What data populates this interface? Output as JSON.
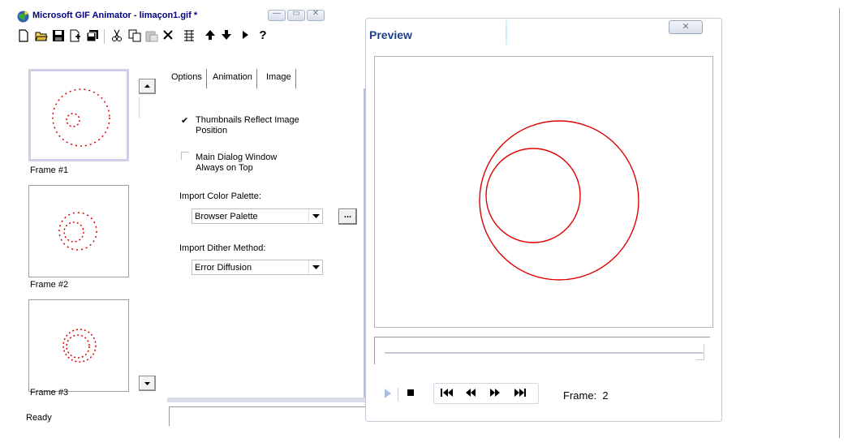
{
  "main_window": {
    "title": "Microsoft GIF Animator - limaçon1.gif *",
    "caption_buttons": {
      "minimize": "—",
      "maximize": "▭",
      "close": "✕"
    },
    "toolbar": [
      {
        "icon": "new-file-icon"
      },
      {
        "icon": "open-folder-icon"
      },
      {
        "icon": "save-icon"
      },
      {
        "icon": "insert-icon"
      },
      {
        "icon": "save-as-icon"
      },
      {
        "icon": "cut-icon"
      },
      {
        "icon": "copy-icon"
      },
      {
        "icon": "paste-icon"
      },
      {
        "icon": "delete-icon"
      },
      {
        "icon": "select-all-icon"
      },
      {
        "icon": "move-up-icon"
      },
      {
        "icon": "move-down-icon"
      },
      {
        "icon": "play-icon"
      },
      {
        "icon": "help-icon"
      }
    ],
    "frames": [
      {
        "label": "Frame #1",
        "selected": true
      },
      {
        "label": "Frame #2",
        "selected": false
      },
      {
        "label": "Frame #3",
        "selected": false
      }
    ],
    "tabs": [
      {
        "label": "Options",
        "active": true
      },
      {
        "label": "Animation",
        "active": false
      },
      {
        "label": "Image",
        "active": false
      }
    ],
    "options": {
      "thumbnails_reflect": {
        "label_line1": "Thumbnails Reflect Image",
        "label_line2": "Position",
        "checked": "✔"
      },
      "always_on_top": {
        "label_line1": "Main Dialog Window",
        "label_line2": "Always on Top",
        "checked": ""
      },
      "import_palette_label": "Import Color Palette:",
      "import_palette_value": "Browser Palette",
      "import_palette_more": "...",
      "import_dither_label": "Import Dither Method:",
      "import_dither_value": "Error Diffusion"
    },
    "status": "Ready"
  },
  "preview_window": {
    "title": "Preview",
    "close": "✕",
    "frame_label": "Frame:",
    "frame_value": "2",
    "curve_color": "#e00000"
  }
}
